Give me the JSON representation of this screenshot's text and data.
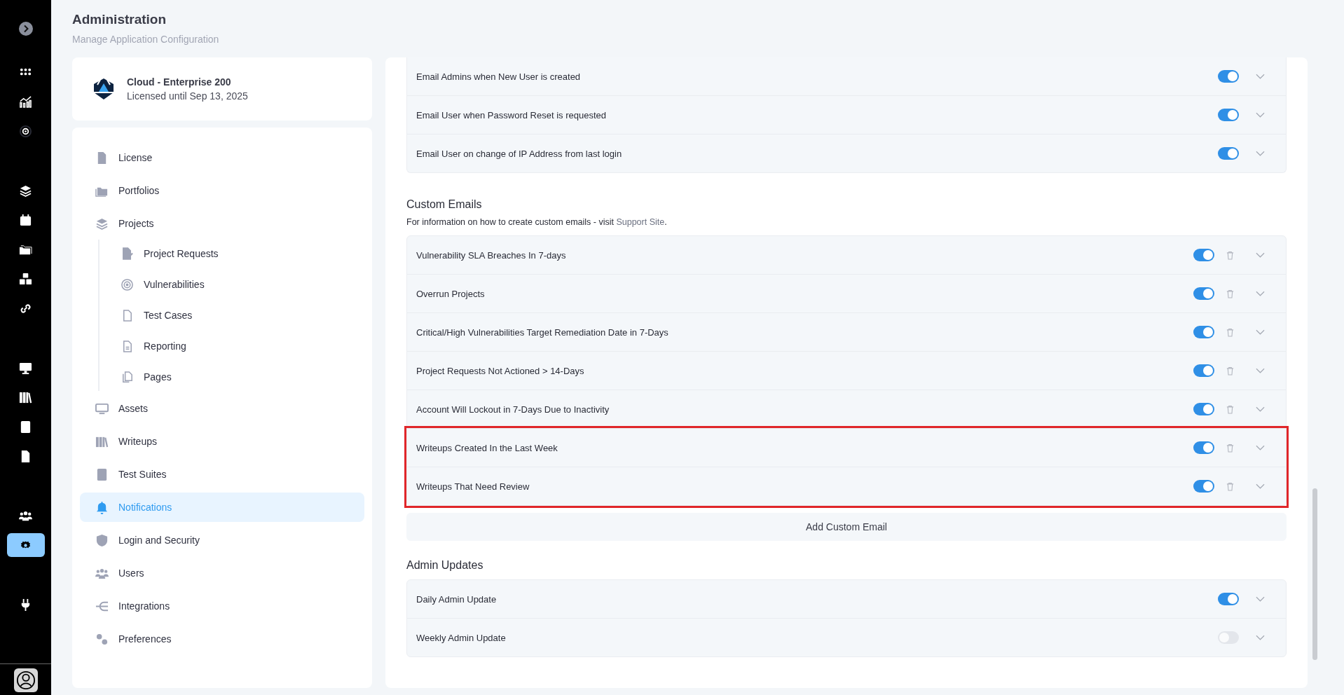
{
  "header": {
    "title": "Administration",
    "subtitle": "Manage Application Configuration"
  },
  "license": {
    "plan": "Cloud - Enterprise 200",
    "expiry": "Licensed until Sep 13, 2025"
  },
  "rail": {
    "items": [
      {
        "selected": false
      },
      {
        "selected": false
      },
      {
        "selected": false
      },
      {
        "selected": false
      },
      {
        "selected": false
      },
      {
        "selected": false
      },
      {
        "selected": false
      },
      {
        "selected": false
      },
      {
        "selected": false
      },
      {
        "selected": false
      },
      {
        "selected": false
      },
      {
        "selected": false
      },
      {
        "selected": false
      },
      {
        "selected": true
      },
      {
        "selected": false
      }
    ]
  },
  "nav": {
    "items": [
      {
        "label": "License",
        "selected": false
      },
      {
        "label": "Portfolios",
        "selected": false
      },
      {
        "label": "Projects",
        "selected": false,
        "children": [
          {
            "label": "Project Requests",
            "selected": false
          },
          {
            "label": "Vulnerabilities",
            "selected": false
          },
          {
            "label": "Test Cases",
            "selected": false
          },
          {
            "label": "Reporting",
            "selected": false
          },
          {
            "label": "Pages",
            "selected": false
          }
        ]
      },
      {
        "label": "Assets",
        "selected": false
      },
      {
        "label": "Writeups",
        "selected": false
      },
      {
        "label": "Test Suites",
        "selected": false
      },
      {
        "label": "Notifications",
        "selected": true
      },
      {
        "label": "Login and Security",
        "selected": false
      },
      {
        "label": "Users",
        "selected": false
      },
      {
        "label": "Integrations",
        "selected": false
      },
      {
        "label": "Preferences",
        "selected": false
      }
    ]
  },
  "section_1": {
    "rows": [
      {
        "label": "Email Admins when New User is created",
        "on": true
      },
      {
        "label": "Email User when Password Reset is requested",
        "on": true
      },
      {
        "label": "Email User on change of IP Address from last login",
        "on": true
      }
    ]
  },
  "custom_emails": {
    "title": "Custom Emails",
    "note": "For information on how to create custom emails - visit",
    "link": "Support Site",
    "note_end": ".",
    "groups": [
      {
        "highlighted": false,
        "rows": [
          {
            "label": "Vulnerability SLA Breaches In 7-days",
            "on": true
          },
          {
            "label": "Overrun Projects",
            "on": true
          },
          {
            "label": "Critical/High Vulnerabilities Target Remediation Date in 7-Days",
            "on": true
          },
          {
            "label": "Project Requests Not Actioned > 14-Days",
            "on": true
          },
          {
            "label": "Account Will Lockout in 7-Days Due to Inactivity",
            "on": true
          }
        ]
      },
      {
        "highlighted": true,
        "rows": [
          {
            "label": "Writeups Created In the Last Week",
            "on": true
          },
          {
            "label": "Writeups That Need Review",
            "on": true
          }
        ]
      }
    ],
    "add_button": "Add Custom Email"
  },
  "admin_updates": {
    "title": "Admin Updates",
    "rows": [
      {
        "label": "Daily Admin Update",
        "on": true
      },
      {
        "label": "Weekly Admin Update",
        "on": false
      }
    ]
  }
}
